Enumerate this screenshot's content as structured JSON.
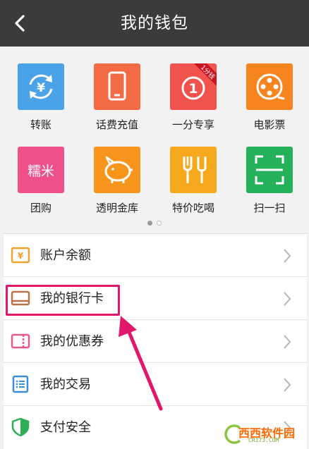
{
  "header": {
    "title": "我的钱包",
    "back_icon": "back-arrow-icon"
  },
  "grid": {
    "items": [
      {
        "label": "转账",
        "icon": "transfer-icon",
        "color": "#4aa3e8"
      },
      {
        "label": "话费充值",
        "icon": "phone-icon",
        "color": "#f26b44"
      },
      {
        "label": "一分专享",
        "icon": "one-cent-icon",
        "color": "#f0524e",
        "badge": "1分钱"
      },
      {
        "label": "电影票",
        "icon": "film-reel-icon",
        "color": "#f6841f"
      },
      {
        "label": "团购",
        "icon": "nuomi-icon",
        "color": "#f0508a",
        "tile_text": "糯米"
      },
      {
        "label": "透明金库",
        "icon": "piggy-bank-icon",
        "color": "#f7951d"
      },
      {
        "label": "特价吃喝",
        "icon": "cutlery-icon",
        "color": "#f6a81c"
      },
      {
        "label": "扫一扫",
        "icon": "scan-icon",
        "color": "#25b05a"
      }
    ],
    "page_dots": {
      "count": 2,
      "active": 1
    }
  },
  "list": {
    "rows": [
      {
        "label": "账户余额",
        "icon": "yuan-card-icon",
        "color": "#f0a22e"
      },
      {
        "label": "我的银行卡",
        "icon": "bank-card-icon",
        "color": "#b8734a"
      },
      {
        "label": "我的优惠券",
        "icon": "coupon-icon",
        "color": "#e35a8a"
      },
      {
        "label": "我的交易",
        "icon": "transaction-list-icon",
        "color": "#3a8fd6"
      },
      {
        "label": "支付安全",
        "icon": "shield-icon",
        "color": "#2fae56"
      }
    ]
  },
  "annotation": {
    "highlight_color": "#e0176b",
    "target": "我的银行卡"
  },
  "watermark": {
    "text": "西西软件园",
    "sub": "CR173.COM"
  }
}
